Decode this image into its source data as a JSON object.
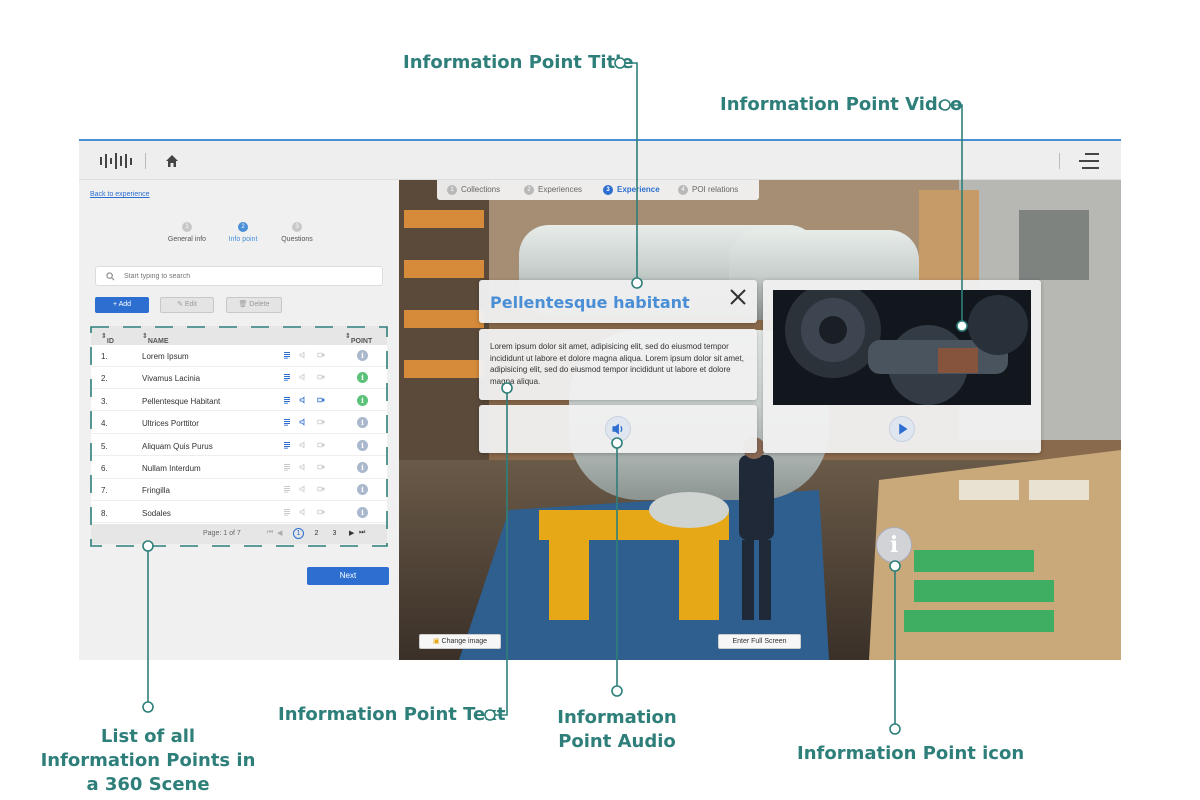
{
  "callouts": {
    "title": "Information Point Title",
    "video": "Information Point Video",
    "list": "List of all Information Points in a 360 Scene",
    "text": "Information Point Text",
    "audio": "Information Point Audio",
    "icon": "Information Point icon"
  },
  "sidebar": {
    "back_link": "Back to experience",
    "steps": [
      {
        "num": "1",
        "label": "General info"
      },
      {
        "num": "2",
        "label": "Info point"
      },
      {
        "num": "3",
        "label": "Questions"
      }
    ],
    "search_placeholder": "Start typing to search",
    "buttons": {
      "add": "Add",
      "edit": "Edit",
      "delete": "Delete",
      "next": "Next"
    },
    "table": {
      "headers": {
        "id": "ID",
        "name": "NAME",
        "point": "POINT"
      },
      "rows": [
        {
          "id": "1.",
          "name": "Lorem Ipsum",
          "text": true,
          "audio": false,
          "video": false,
          "point_color": "#a9b8cc"
        },
        {
          "id": "2.",
          "name": "Vivamus Lacinia",
          "text": true,
          "audio": false,
          "video": false,
          "point_color": "#5cc27a"
        },
        {
          "id": "3.",
          "name": "Pellentesque Habitant",
          "text": true,
          "audio": true,
          "video": true,
          "point_color": "#5cc27a"
        },
        {
          "id": "4.",
          "name": "Ultrices Porttitor",
          "text": true,
          "audio": true,
          "video": false,
          "point_color": "#a9b8cc"
        },
        {
          "id": "5.",
          "name": "Aliquam Quis Purus",
          "text": true,
          "audio": false,
          "video": false,
          "point_color": "#a9b8cc"
        },
        {
          "id": "6.",
          "name": "Nullam Interdum",
          "text": false,
          "audio": false,
          "video": false,
          "point_color": "#a9b8cc"
        },
        {
          "id": "7.",
          "name": "Fringilla",
          "text": false,
          "audio": false,
          "video": false,
          "point_color": "#a9b8cc"
        },
        {
          "id": "8.",
          "name": "Sodales",
          "text": false,
          "audio": false,
          "video": false,
          "point_color": "#a9b8cc"
        }
      ],
      "point_glyph": "i",
      "footer": {
        "page_label": "Page: 1 of 7",
        "pages": [
          "1",
          "2",
          "3"
        ],
        "current_page": "1"
      }
    }
  },
  "scene": {
    "steps": [
      {
        "num": "1",
        "label": "Collections"
      },
      {
        "num": "2",
        "label": "Experiences"
      },
      {
        "num": "3",
        "label": "Experience"
      },
      {
        "num": "4",
        "label": "POI relations"
      }
    ],
    "info_title": "Pellentesque habitant",
    "info_text": "Lorem ipsum dolor sit amet, adipisicing elit, sed do eiusmod tempor incididunt ut labore et dolore magna aliqua. Lorem ipsum dolor sit amet, adipisicing elit, sed do eiusmod tempor incididunt ut labore et dolore magna aliqua.",
    "marker_glyph": "i",
    "change_image": "Change image",
    "full_screen": "Enter Full Screen"
  },
  "colors": {
    "accent": "#2d6fd0",
    "callout": "#2e7f7a",
    "active_point": "#5cc27a"
  }
}
